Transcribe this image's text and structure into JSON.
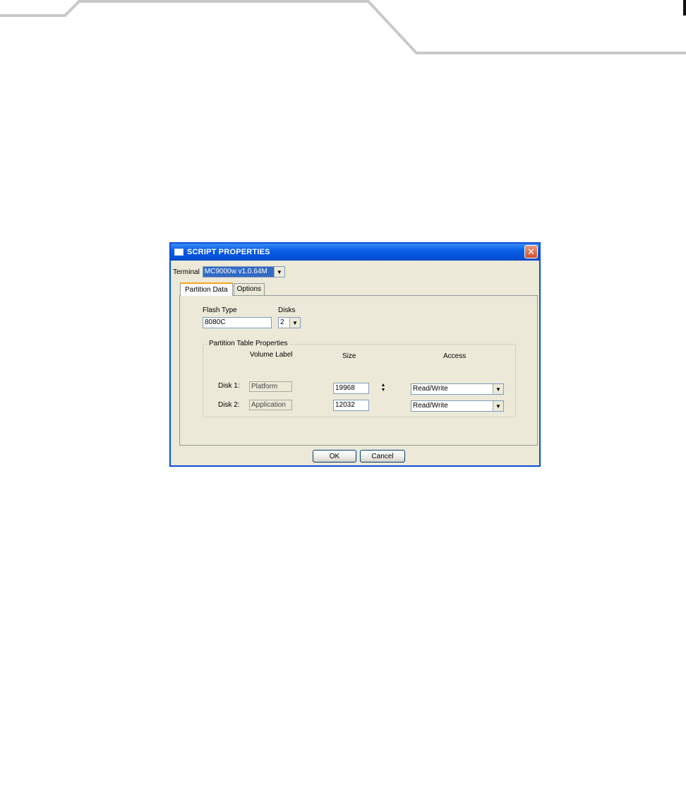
{
  "dialog": {
    "title": "SCRIPT PROPERTIES",
    "close_glyph": "✕",
    "terminal": {
      "label": "Terminal",
      "value": "MC9000w v1.0.64M"
    },
    "tabs": [
      {
        "label": "Partition Data",
        "active": true
      },
      {
        "label": "Options",
        "active": false
      }
    ],
    "flash_type": {
      "label": "Flash Type",
      "value": "8080C"
    },
    "disks": {
      "label": "Disks",
      "value": "2"
    },
    "partition_table": {
      "title": "Partition Table Properties",
      "headers": {
        "volume_label": "Volume Label",
        "size": "Size",
        "access": "Access"
      },
      "rows": [
        {
          "label": "Disk 1:",
          "volume_label": "Platform",
          "size": "19968",
          "access": "Read/Write"
        },
        {
          "label": "Disk 2:",
          "volume_label": "Application",
          "size": "12032",
          "access": "Read/Write"
        }
      ]
    },
    "buttons": {
      "ok": "OK",
      "cancel": "Cancel"
    }
  },
  "icons": {
    "combo_arrow": "▼",
    "spin_up": "▲",
    "spin_down": "▼"
  },
  "colors": {
    "titlebar": "#0350d6",
    "dialog_bg": "#ece9d8",
    "selection": "#316ac5",
    "tab_highlight": "#f5a623",
    "close_button": "#d0502e"
  }
}
